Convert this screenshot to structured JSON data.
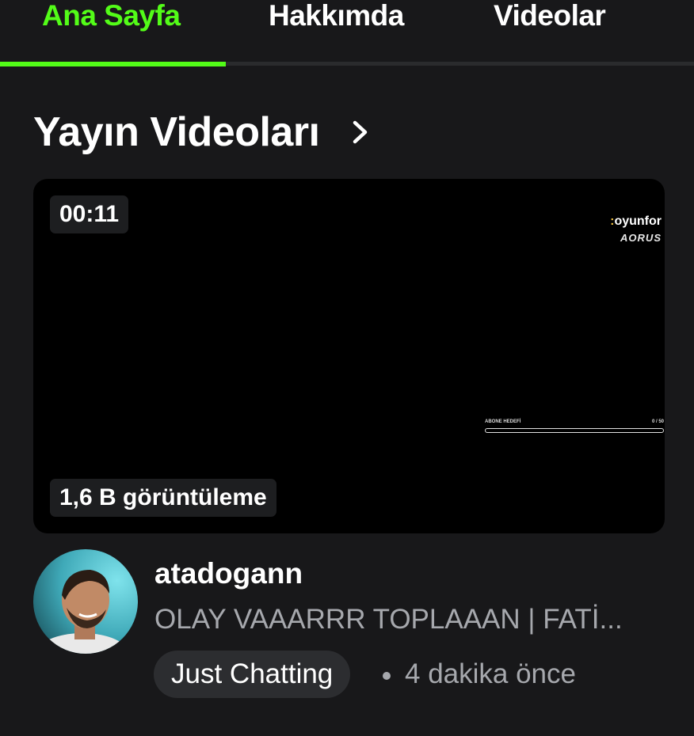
{
  "tabs": [
    {
      "label": "Ana Sayfa",
      "active": true
    },
    {
      "label": "Hakkımda",
      "active": false
    },
    {
      "label": "Videolar",
      "active": false
    }
  ],
  "section": {
    "title": "Yayın Videoları",
    "chevron_icon": "chevron-right-icon"
  },
  "video": {
    "duration": "00:11",
    "views": "1,6 B görüntüleme",
    "overlay": {
      "logo_top": "oyunfor",
      "logo_bottom": "AORUS",
      "goal_label": "ABONE HEDEFİ",
      "goal_value": "0 / 50"
    },
    "channel": "atadogann",
    "title": "OLAY VAAARRR TOPLAAAN | FATİ...",
    "category": "Just Chatting",
    "time_ago": "4 dakika önce"
  },
  "colors": {
    "background": "#18181a",
    "accent": "#53fc18",
    "muted_text": "#a6a8ad",
    "badge_bg": "#1d1e20",
    "tag_bg": "#2c2d30"
  }
}
